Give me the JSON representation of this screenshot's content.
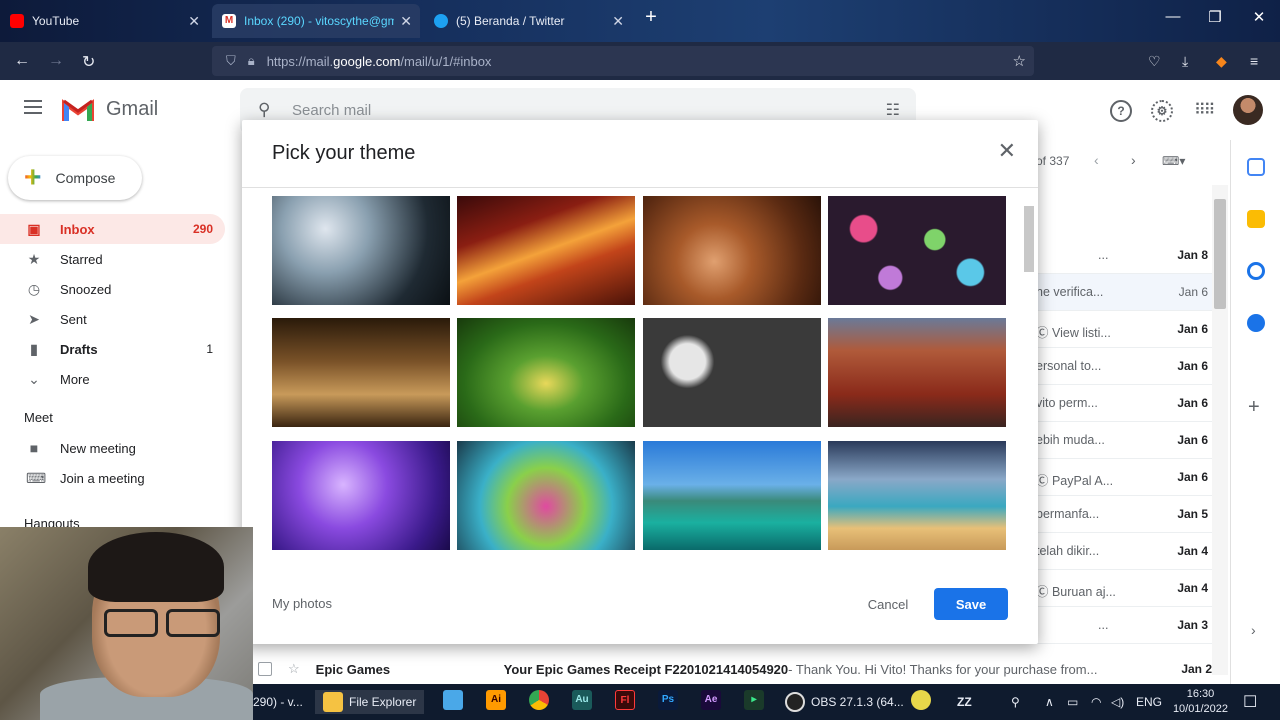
{
  "browser": {
    "tabs": [
      {
        "label": "YouTube",
        "icon": "youtube-icon"
      },
      {
        "label": "Inbox (290) - vitoscythe@gmail",
        "icon": "gmail-icon"
      },
      {
        "label": "(5) Beranda / Twitter",
        "icon": "twitter-icon"
      }
    ],
    "url_prefix": "https://mail.",
    "url_domain": "google.com",
    "url_suffix": "/mail/u/1/#inbox"
  },
  "gmail": {
    "app_name": "Gmail",
    "search_placeholder": "Search mail",
    "compose_label": "Compose",
    "nav": [
      {
        "label": "Inbox",
        "count": "290"
      },
      {
        "label": "Starred",
        "count": ""
      },
      {
        "label": "Snoozed",
        "count": ""
      },
      {
        "label": "Sent",
        "count": ""
      },
      {
        "label": "Drafts",
        "count": "1"
      },
      {
        "label": "More",
        "count": ""
      }
    ],
    "meet_title": "Meet",
    "meet_items": [
      "New meeting",
      "Join a meeting"
    ],
    "hangouts_title": "Hangouts",
    "pager_text": "of 337",
    "rows": [
      {
        "snippet": "...",
        "date": "Jan 8"
      },
      {
        "snippet": "he verifica...",
        "date": "Jan 6"
      },
      {
        "snippet": "Ⓒ View listi...",
        "date": "Jan 6"
      },
      {
        "snippet": "ersonal to...",
        "date": "Jan 6"
      },
      {
        "snippet": "vito perm...",
        "date": "Jan 6"
      },
      {
        "snippet": "ebih muda...",
        "date": "Jan 6"
      },
      {
        "snippet": "Ⓒ PayPal A...",
        "date": "Jan 6"
      },
      {
        "snippet": "bermanfa...",
        "date": "Jan 5"
      },
      {
        "snippet": "telah dikir...",
        "date": "Jan 4"
      },
      {
        "snippet": "Ⓒ Buruan aj...",
        "date": "Jan 4"
      },
      {
        "snippet": "...",
        "date": "Jan 3"
      }
    ],
    "bottom_row": {
      "sender": "Epic Games",
      "subject": "Your Epic Games Receipt F2201021414054920",
      "preview": " - Thank You. Hi Vito! Thanks for your purchase from...",
      "date": "Jan 2"
    }
  },
  "dialog": {
    "title": "Pick your theme",
    "my_photos": "My photos",
    "cancel": "Cancel",
    "save": "Save",
    "themes": [
      {
        "name": "dandelion-theme"
      },
      {
        "name": "canyon-waves-theme"
      },
      {
        "name": "autumn-leaves-theme"
      },
      {
        "name": "bokeh-theme"
      },
      {
        "name": "chess-theme"
      },
      {
        "name": "caterpillar-theme"
      },
      {
        "name": "pipes-theme"
      },
      {
        "name": "red-canyon-theme"
      },
      {
        "name": "jellyfish-theme"
      },
      {
        "name": "water-drop-theme"
      },
      {
        "name": "lake-tahoe-theme"
      },
      {
        "name": "beach-theme"
      }
    ]
  },
  "taskbar": {
    "items": [
      {
        "label": "290) - v..."
      },
      {
        "label": "File Explorer"
      },
      {
        "label": "OBS 27.1.3 (64..."
      }
    ],
    "lang": "ENG",
    "time": "16:30",
    "date": "10/01/2022"
  }
}
